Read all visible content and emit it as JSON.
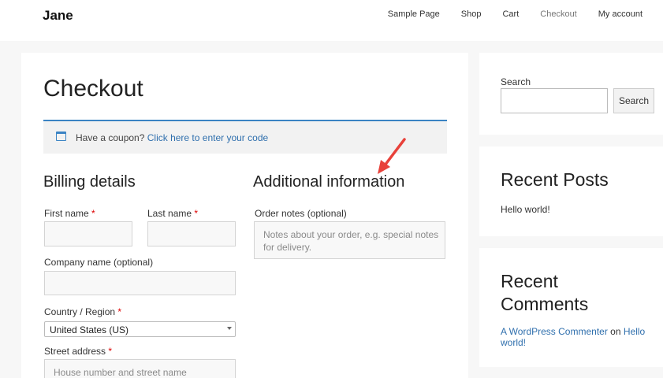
{
  "header": {
    "site_title": "Jane",
    "nav": [
      "Sample Page",
      "Shop",
      "Cart",
      "Checkout",
      "My account"
    ]
  },
  "main": {
    "page_title": "Checkout",
    "coupon": {
      "text": "Have a coupon?",
      "link": "Click here to enter your code"
    },
    "billing": {
      "title": "Billing details",
      "first_name_label": "First name",
      "last_name_label": "Last name",
      "company_label": "Company name (optional)",
      "country_label": "Country / Region",
      "country_value": "United States (US)",
      "street_label": "Street address",
      "street_placeholder": "House number and street name",
      "required_mark": "*"
    },
    "additional": {
      "title": "Additional information",
      "order_notes_label": "Order notes (optional)",
      "order_notes_placeholder": "Notes about your order, e.g. special notes for delivery."
    }
  },
  "sidebar": {
    "search_label": "Search",
    "search_button": "Search",
    "recent_posts_title": "Recent Posts",
    "recent_posts": [
      "Hello world!"
    ],
    "recent_comments_title": "Recent Comments",
    "comment": {
      "author": "A WordPress Commenter",
      "on": "on",
      "post": "Hello world!"
    }
  },
  "colors": {
    "accent": "#3b84c4",
    "link": "#2f6fad",
    "required": "#dd0000",
    "annotation_arrow": "#e8413a"
  },
  "icons": [
    "calendar-icon",
    "select-arrow-icon",
    "annotation-arrow-icon"
  ]
}
